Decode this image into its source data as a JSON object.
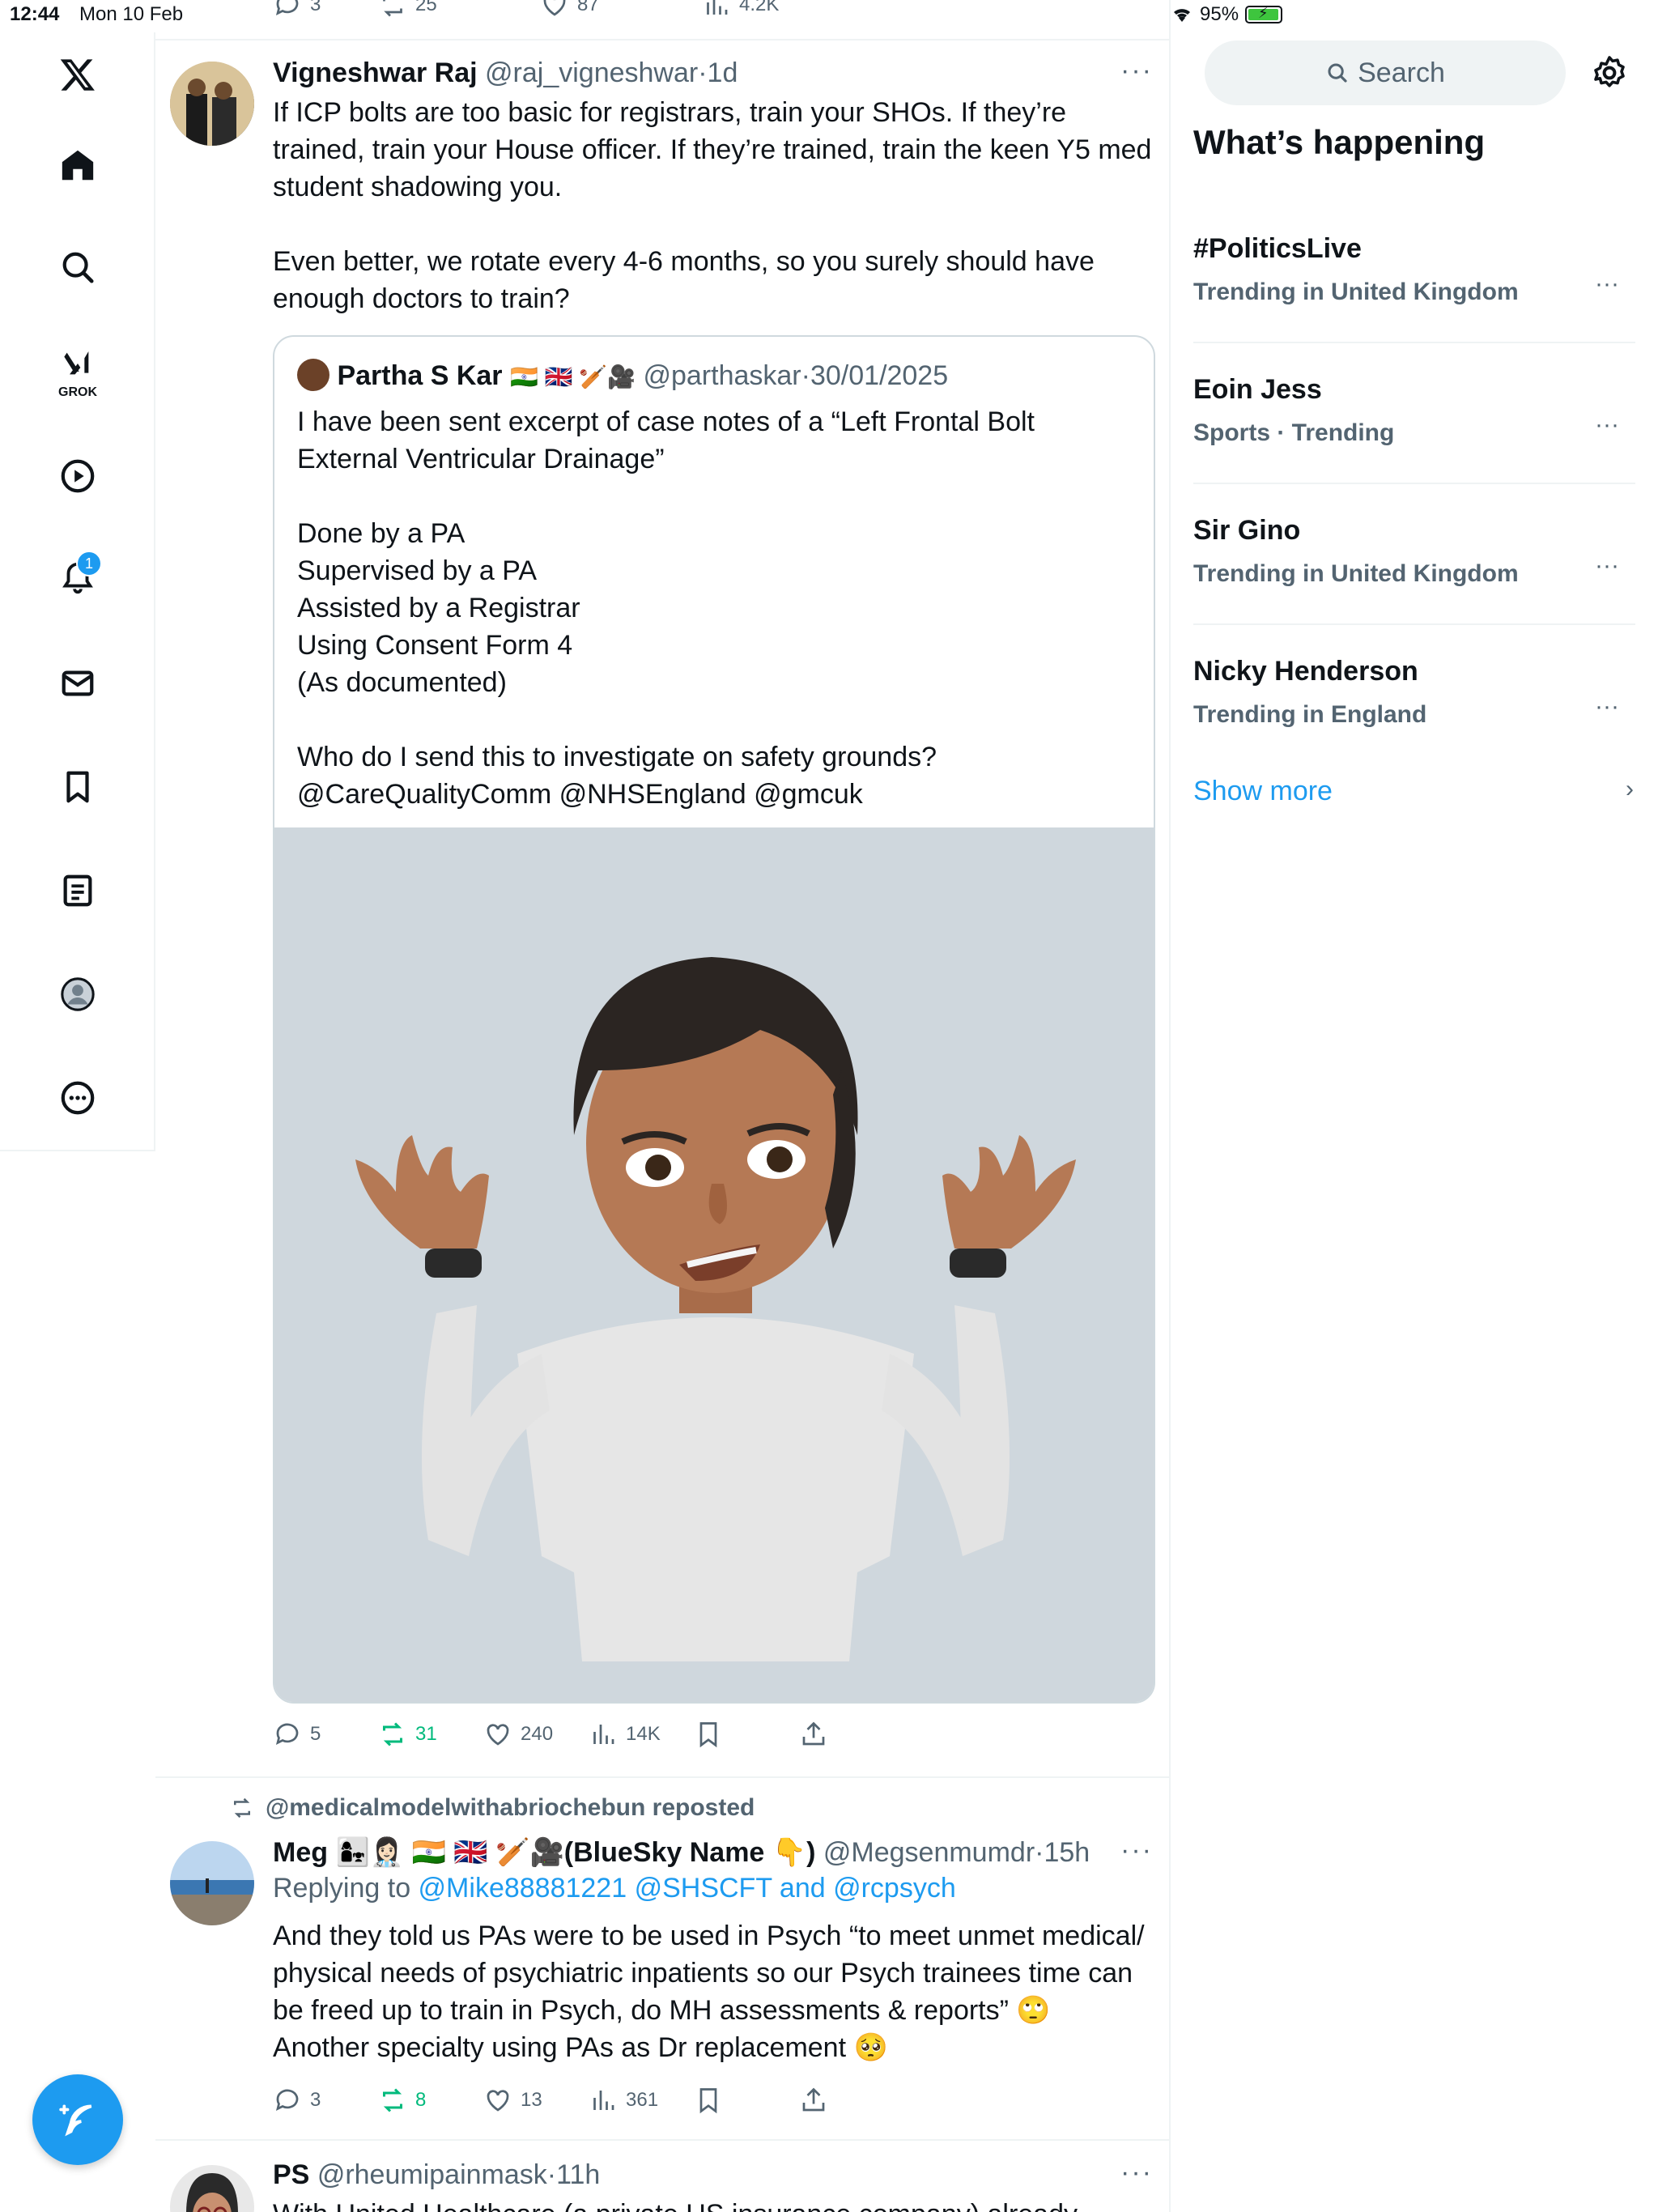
{
  "status_bar": {
    "time": "12:44",
    "date": "Mon 10 Feb",
    "battery": "95%"
  },
  "nav": {
    "grok_label": "GROK",
    "notification_count": "1"
  },
  "top_stats": {
    "replies": "3",
    "reposts": "25",
    "likes": "87",
    "views": "4.2K"
  },
  "post1": {
    "display_name": "Vigneshwar Raj",
    "handle": "@raj_vigneshwar",
    "dot": "·",
    "time": "1d",
    "text_p1": "If ICP bolts are too basic for registrars, train your SHOs. If they’re trained, train your House officer. If they’re trained, train the keen Y5 med student shadowing you.",
    "text_p2": "Even better, we rotate every 4-6 months, so you surely should have enough doctors to train?",
    "quote": {
      "display_name": "Partha S Kar",
      "flags": "🇮🇳 🇬🇧 🏏🎥",
      "handle": "@parthaskar",
      "dot": "·",
      "date": "30/01/2025",
      "line1": "I have been sent excerpt of case notes of a “Left Frontal Bolt External Ventricular Drainage”",
      "line2": "Done by a PA",
      "line3": "Supervised by a PA",
      "line4": "Assisted by a Registrar",
      "line5": "Using Consent Form 4",
      "line6": "(As documented)",
      "line7": "Who do I send this to investigate on safety grounds?",
      "line8": "@CareQualityComm @NHSEngland @gmcuk"
    },
    "stats": {
      "replies": "5",
      "reposts": "31",
      "likes": "240",
      "views": "14K"
    }
  },
  "post2": {
    "repost_label": "@medicalmodelwithabriochebun reposted",
    "display_name": "Meg 👩‍👧👩🏻‍⚕️ 🇮🇳 🇬🇧 🏏🎥(BlueSky Name 👇)",
    "handle": "@Megsenmumdr",
    "dot": "·",
    "time": "15h",
    "replying_prefix": "Replying to ",
    "replying_to": "@Mike88881221 @SHSCFT and @rcpsych",
    "text": "And they told us PAs were to be used in Psych “to meet unmet medical/ physical needs of psychiatric inpatients so our Psych trainees time can be freed up to train in Psych, do MH assessments & reports” 🙄 Another specialty using PAs as Dr replacement 🥺",
    "stats": {
      "replies": "3",
      "reposts": "8",
      "likes": "13",
      "views": "361"
    }
  },
  "post3": {
    "display_name": "PS",
    "handle": "@rheumipainmask",
    "dot": "·",
    "time": "11h",
    "text": "With United Healthcare (a private US insurance company) already"
  },
  "sidebar": {
    "search_placeholder": "Search",
    "title": "What’s happening",
    "trends": [
      {
        "name": "#PoliticsLive",
        "context": "Trending in United Kingdom"
      },
      {
        "name": "Eoin Jess",
        "context": "Sports · Trending"
      },
      {
        "name": "Sir Gino",
        "context": "Trending in United Kingdom"
      },
      {
        "name": "Nicky Henderson",
        "context": "Trending in England"
      }
    ],
    "show_more": "Show more"
  },
  "colors": {
    "accent": "#1d9bf0",
    "repost_green": "#00ba7c",
    "muted": "#536471",
    "border": "#eff3f4"
  }
}
